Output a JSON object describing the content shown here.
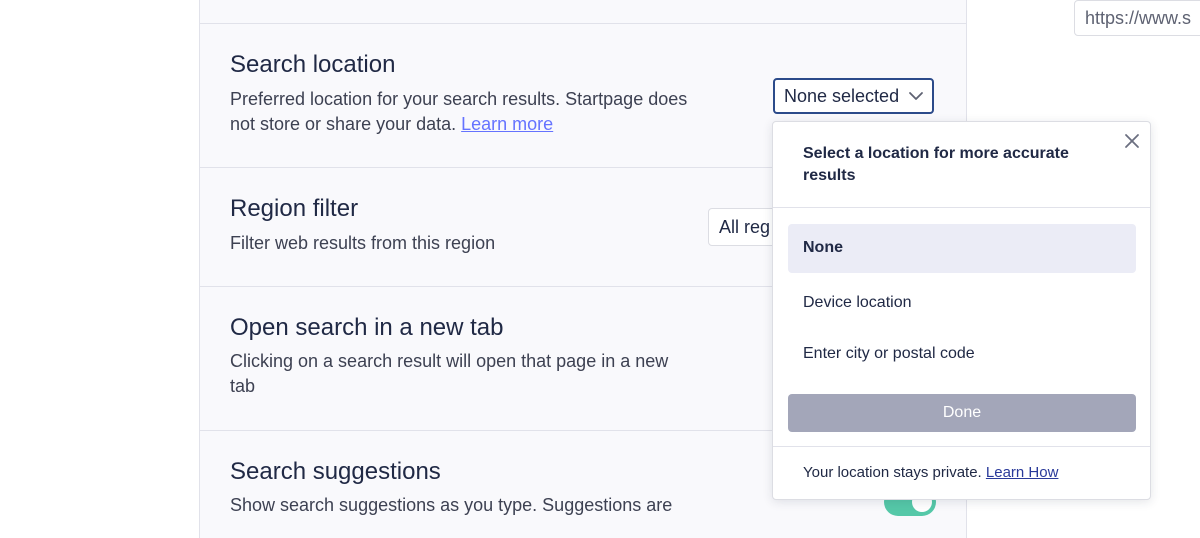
{
  "url_bar": {
    "text": "https://www.s"
  },
  "settings": {
    "search_location": {
      "title": "Search location",
      "desc_line1": "Preferred location for your search results. Startpage does",
      "desc_line2": "not store or share your data.",
      "learn_more": "Learn more",
      "select_value": "None selected"
    },
    "region_filter": {
      "title": "Region filter",
      "desc": "Filter web results from this region",
      "select_value": "All reg"
    },
    "new_tab": {
      "title": "Open search in a new tab",
      "desc_line1": "Clicking on a search result will open that page in a new",
      "desc_line2": "tab"
    },
    "search_suggestions": {
      "title": "Search suggestions",
      "desc_line1": "Show search suggestions as you type. Suggestions are",
      "toggle_on": true
    }
  },
  "location_popup": {
    "heading": "Select a location for more accurate results",
    "options": [
      {
        "label": "None",
        "selected": true
      },
      {
        "label": "Device location",
        "selected": false
      },
      {
        "label": "Enter city or postal code",
        "selected": false
      }
    ],
    "done_label": "Done",
    "privacy_text": "Your location stays private.",
    "privacy_link": "Learn How"
  },
  "colors": {
    "accent_link": "#6573ff",
    "select_border_focus": "#2c4b8a",
    "toggle_on": "#55c8a8",
    "done_disabled": "#a3a6b9",
    "selected_option_bg": "#ebecf6"
  },
  "icons": {
    "select_arrow": "chevron-down-icon",
    "popup_close": "close-icon"
  }
}
